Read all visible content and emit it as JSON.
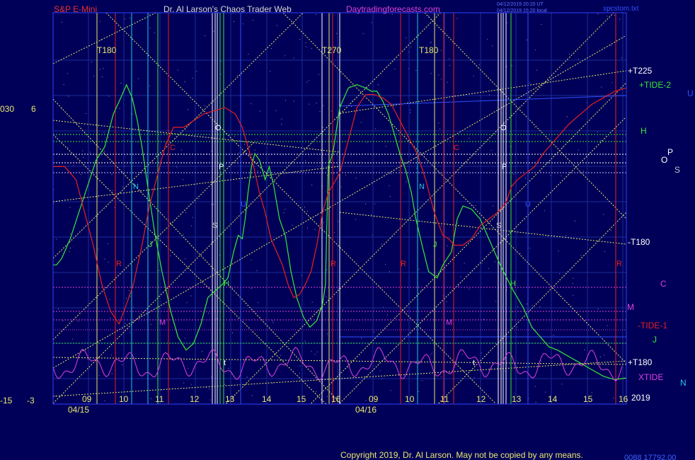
{
  "header": {
    "symbol": "S&P E-Mini",
    "title": "Dr. Al Larson's Chaos Trader Web",
    "site": "Daytradingforecasts.com",
    "stamp1": "04/12/2019 20:20 UT",
    "stamp2": "04/12/2019 15:20 local",
    "file": "spcstom.txt"
  },
  "footer": {
    "copyright": "Copyright 2019, Dr. Al Larson. May not be copied by any means.",
    "code": "0088 17792.00"
  },
  "colors": {
    "background": "#000058",
    "plot_border": "#3040ff",
    "grid": "#1c2c9a",
    "yellow": "#e8e870",
    "green": "#38e838",
    "red": "#e82020",
    "magenta": "#e040e0",
    "cyan": "#20c8e0",
    "white": "#ffffff",
    "purple_line": "#a030d0"
  },
  "chart_data": {
    "type": "line",
    "title": "S&P E-Mini",
    "x_axis": {
      "dates": [
        "04/15",
        "04/16"
      ],
      "hours": [
        "09",
        "10",
        "11",
        "12",
        "13",
        "14",
        "15",
        "16",
        "09",
        "10",
        "11",
        "12",
        "13",
        "14",
        "15",
        "16"
      ]
    },
    "y_labels_left": [
      {
        "text": "030",
        "level": 6
      },
      {
        "text": "6",
        "level": 6
      },
      {
        "text": "-15",
        "level": -15
      },
      {
        "text": "-3",
        "level": -3
      }
    ],
    "year_label": "2019",
    "series": [
      {
        "name": "TIDE-2",
        "color": "green",
        "x": [
          0,
          0.006,
          0.015,
          0.03,
          0.045,
          0.06,
          0.075,
          0.09,
          0.105,
          0.118,
          0.128,
          0.138,
          0.147,
          0.155,
          0.165,
          0.178,
          0.19,
          0.205,
          0.218,
          0.232,
          0.245,
          0.258,
          0.27,
          0.282,
          0.295,
          0.305,
          0.315,
          0.323,
          0.33,
          0.335,
          0.34,
          0.346,
          0.352,
          0.36,
          0.37,
          0.377,
          0.385,
          0.395,
          0.405,
          0.415,
          0.425,
          0.437,
          0.448,
          0.46,
          0.47,
          0.475,
          0.48,
          0.488,
          0.5,
          0.515,
          0.53,
          0.545,
          0.555,
          0.565,
          0.575,
          0.585,
          0.595,
          0.605,
          0.615,
          0.625,
          0.633,
          0.645,
          0.655,
          0.67,
          0.68,
          0.695,
          0.705,
          0.715,
          0.73,
          0.745,
          0.76,
          0.78,
          0.8,
          0.82,
          0.835,
          0.85,
          0.865,
          0.88,
          0.9,
          0.92,
          0.94,
          0.96,
          0.98,
          1.0
        ],
        "y": [
          0.36,
          0.36,
          0.38,
          0.44,
          0.52,
          0.6,
          0.68,
          0.72,
          0.82,
          0.87,
          0.91,
          0.87,
          0.8,
          0.72,
          0.6,
          0.45,
          0.34,
          0.22,
          0.14,
          0.1,
          0.12,
          0.18,
          0.26,
          0.28,
          0.3,
          0.32,
          0.4,
          0.45,
          0.44,
          0.5,
          0.58,
          0.66,
          0.7,
          0.68,
          0.62,
          0.66,
          0.6,
          0.5,
          0.45,
          0.34,
          0.26,
          0.2,
          0.17,
          0.19,
          0.24,
          0.3,
          0.66,
          0.7,
          0.84,
          0.9,
          0.91,
          0.9,
          0.89,
          0.89,
          0.86,
          0.82,
          0.76,
          0.7,
          0.65,
          0.58,
          0.5,
          0.41,
          0.34,
          0.32,
          0.36,
          0.4,
          0.5,
          0.54,
          0.53,
          0.5,
          0.44,
          0.36,
          0.29,
          0.23,
          0.17,
          0.14,
          0.11,
          0.1,
          0.08,
          0.06,
          0.04,
          0.02,
          0.01,
          0.015
        ]
      },
      {
        "name": "TIDE-1",
        "color": "red",
        "x": [
          0,
          0.02,
          0.04,
          0.055,
          0.07,
          0.085,
          0.1,
          0.115,
          0.128,
          0.14,
          0.155,
          0.168,
          0.18,
          0.195,
          0.21,
          0.228,
          0.245,
          0.262,
          0.28,
          0.3,
          0.318,
          0.33,
          0.34,
          0.35,
          0.36,
          0.37,
          0.38,
          0.39,
          0.4,
          0.41,
          0.415,
          0.42,
          0.43,
          0.44,
          0.45,
          0.46,
          0.47,
          0.48,
          0.5,
          0.515,
          0.53,
          0.545,
          0.56,
          0.575,
          0.59,
          0.605,
          0.62,
          0.635,
          0.65,
          0.665,
          0.68,
          0.69,
          0.7,
          0.715,
          0.73,
          0.745,
          0.76,
          0.775,
          0.79,
          0.8,
          0.81,
          0.825,
          0.84,
          0.855,
          0.87,
          0.885,
          0.9,
          0.92,
          0.94,
          0.96,
          0.98,
          1.0
        ],
        "y": [
          0.66,
          0.66,
          0.62,
          0.52,
          0.42,
          0.3,
          0.22,
          0.18,
          0.24,
          0.3,
          0.42,
          0.54,
          0.62,
          0.72,
          0.78,
          0.78,
          0.8,
          0.82,
          0.83,
          0.84,
          0.82,
          0.78,
          0.72,
          0.66,
          0.58,
          0.52,
          0.44,
          0.4,
          0.36,
          0.3,
          0.28,
          0.26,
          0.27,
          0.3,
          0.34,
          0.42,
          0.52,
          0.58,
          0.64,
          0.74,
          0.84,
          0.88,
          0.88,
          0.87,
          0.85,
          0.8,
          0.75,
          0.7,
          0.62,
          0.52,
          0.45,
          0.44,
          0.42,
          0.42,
          0.44,
          0.48,
          0.5,
          0.52,
          0.55,
          0.6,
          0.62,
          0.64,
          0.66,
          0.7,
          0.73,
          0.76,
          0.79,
          0.82,
          0.85,
          0.87,
          0.89,
          0.9
        ]
      },
      {
        "name": "XTIDE",
        "color": "magenta",
        "x": [],
        "y": []
      }
    ],
    "right_labels": [
      "+T225",
      "+TIDE-2",
      "H",
      "O",
      "P",
      "S",
      "-T180",
      "C",
      "M",
      "-TIDE-1",
      "J",
      "+T180",
      "XTIDE",
      "N",
      "U"
    ],
    "vertical_markers": [
      "T180",
      "T270",
      "T180"
    ]
  }
}
